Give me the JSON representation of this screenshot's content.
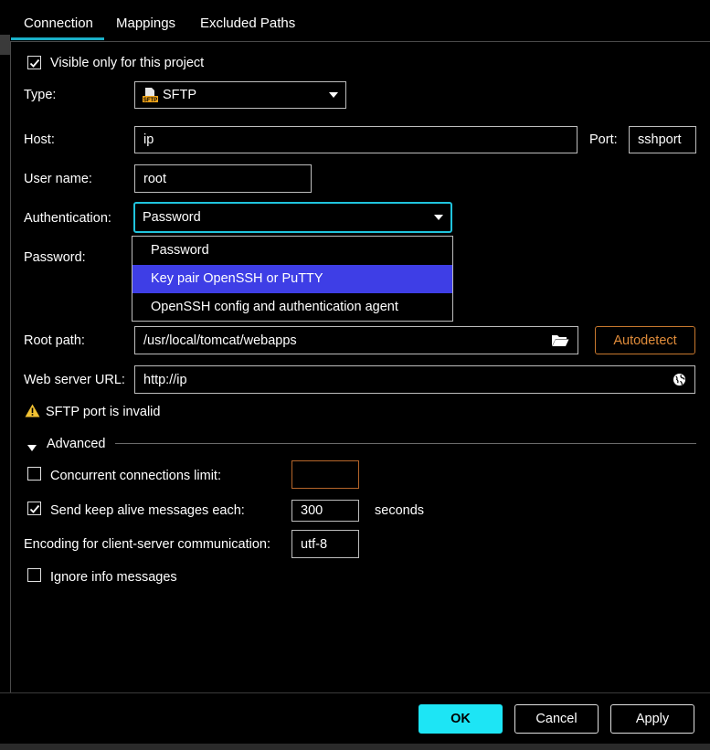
{
  "tabs": [
    {
      "label": "Connection"
    },
    {
      "label": "Mappings"
    },
    {
      "label": "Excluded Paths"
    }
  ],
  "visible_only": {
    "label": "Visible only for this project",
    "checked": true
  },
  "type": {
    "label": "Type:",
    "value": "SFTP",
    "icon": "sftp-icon"
  },
  "host": {
    "label": "Host:",
    "value": "ip"
  },
  "port": {
    "label": "Port:",
    "value": "sshport"
  },
  "username": {
    "label": "User name:",
    "value": "root"
  },
  "authentication": {
    "label": "Authentication:",
    "value": "Password",
    "options": [
      "Password",
      "Key pair OpenSSH or PuTTY",
      "OpenSSH config and authentication agent"
    ],
    "highlighted": "Key pair OpenSSH or PuTTY"
  },
  "password": {
    "label": "Password:"
  },
  "root_path": {
    "label": "Root path:",
    "value": "/usr/local/tomcat/webapps",
    "button": "Autodetect"
  },
  "web_url": {
    "label": "Web server URL:",
    "value": "http://ip"
  },
  "warning": {
    "text": "SFTP port is invalid",
    "icon": "warning-icon"
  },
  "advanced": {
    "label": "Advanced",
    "concurrent": {
      "label": "Concurrent connections limit:",
      "checked": false,
      "value": ""
    },
    "keepalive": {
      "label": "Send keep alive messages each:",
      "checked": true,
      "value": "300",
      "unit": "seconds"
    },
    "encoding": {
      "label": "Encoding for client-server communication:",
      "value": "utf-8"
    },
    "ignore_info": {
      "label": "Ignore info messages",
      "checked": false
    }
  },
  "footer": {
    "ok": "OK",
    "cancel": "Cancel",
    "apply": "Apply"
  },
  "colors": {
    "accent": "#1de5f5",
    "highlight": "#3e3ee6",
    "warning": "#f2c233",
    "autodetect": "#e08c3a"
  }
}
